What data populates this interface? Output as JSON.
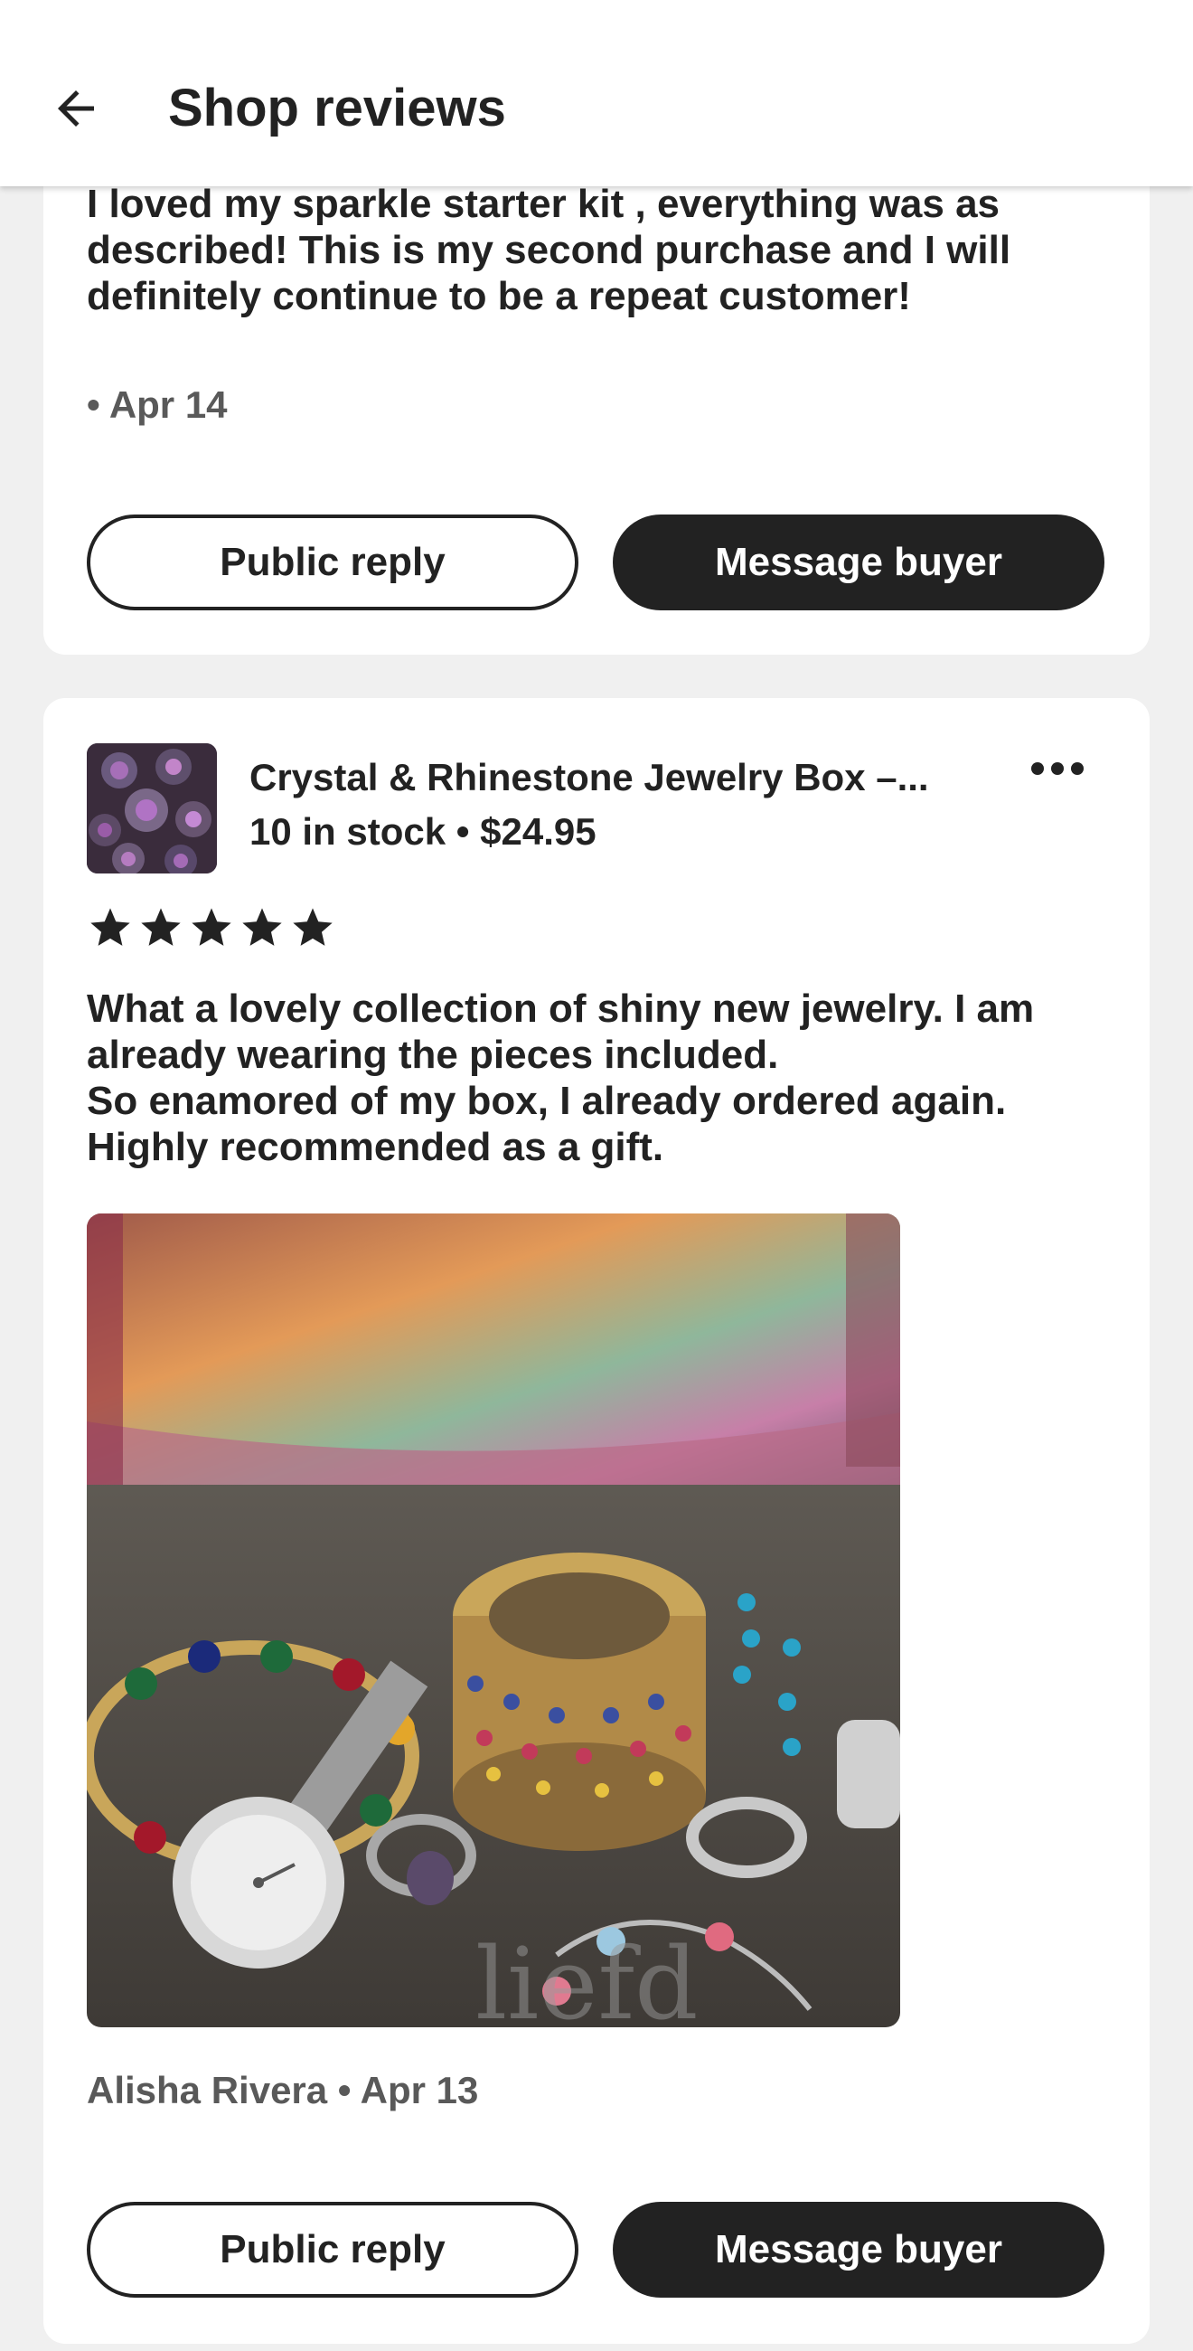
{
  "app_bar": {
    "title": "Shop reviews",
    "back_icon": "arrow-left-icon"
  },
  "reviews": [
    {
      "text": "I loved my sparkle starter kit , everything was as described! This is my second purchase and I will definitely continue to be a repeat customer!",
      "meta": "• Apr 14",
      "public_reply_label": "Public reply",
      "message_buyer_label": "Message buyer"
    },
    {
      "product": {
        "title": "Crystal & Rhinestone Jewelry Box –...",
        "stock_price": "10 in stock • $24.95",
        "thumbnail_icon": "product-thumbnail"
      },
      "rating": 5,
      "rating_max": 5,
      "more_icon": "more-horizontal-icon",
      "text": "What a lovely collection of shiny new jewelry. I am\nalready wearing the pieces included.\nSo enamored of my box, I already ordered again.\nHighly recommended as a gift.",
      "photo": "review-photo-jewelry",
      "meta": "Alisha Rivera • Apr 13",
      "public_reply_label": "Public reply",
      "message_buyer_label": "Message buyer"
    }
  ],
  "colors": {
    "text": "#222222",
    "muted": "#595959",
    "background": "#f0f0f0",
    "card": "#ffffff",
    "button_filled": "#222222"
  }
}
